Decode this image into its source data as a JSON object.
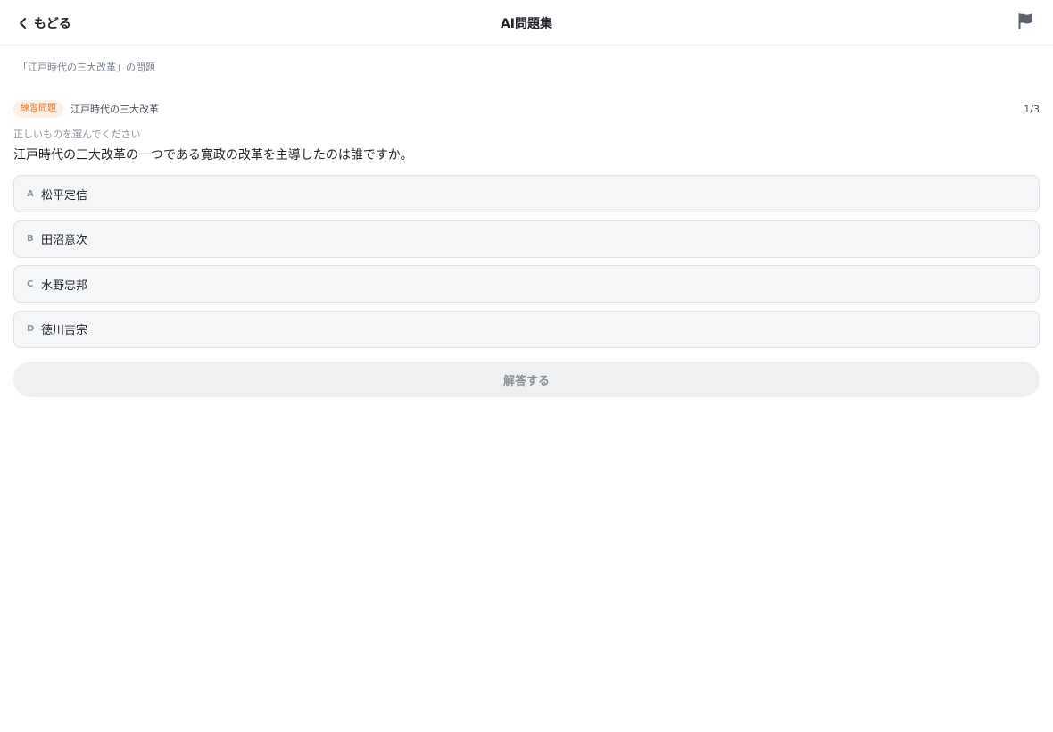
{
  "header": {
    "back_label": "もどる",
    "title": "AI問題集",
    "back_icon": "chevron-left-icon",
    "flag_icon": "flag-icon"
  },
  "breadcrumb": "「江戸時代の三大改革」の問題",
  "question": {
    "badge": "練習問題",
    "topic": "江戸時代の三大改革",
    "progress": "1/3",
    "instruction": "正しいものを選んでください",
    "text": "江戸時代の三大改革の一つである寛政の改革を主導したのは誰ですか。",
    "options": [
      {
        "letter": "A",
        "text": "松平定信"
      },
      {
        "letter": "B",
        "text": "田沼意次"
      },
      {
        "letter": "C",
        "text": "水野忠邦"
      },
      {
        "letter": "D",
        "text": "徳川吉宗"
      }
    ]
  },
  "submit_label": "解答する",
  "colors": {
    "badge_bg": "#fdf0e6",
    "badge_text": "#e07a2d",
    "option_bg": "#f5f6f8",
    "submit_bg": "#eef0f2"
  }
}
